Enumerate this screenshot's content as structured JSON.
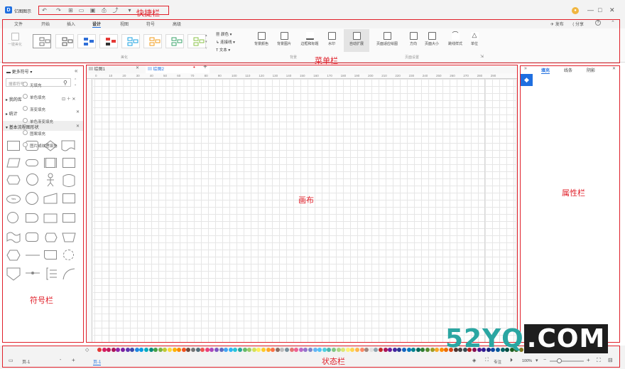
{
  "app": {
    "name": "亿图图示"
  },
  "titlebar": {
    "quick_label": "快捷栏",
    "window_controls": [
      "—",
      "□",
      "✕"
    ]
  },
  "tabs": [
    {
      "label": "文件"
    },
    {
      "label": "开始"
    },
    {
      "label": "插入"
    },
    {
      "label": "设计"
    },
    {
      "label": "视图"
    },
    {
      "label": "符号"
    },
    {
      "label": "高级"
    }
  ],
  "tabs_right": {
    "publish": "发布",
    "share": "分享",
    "help": "?"
  },
  "ribbon": {
    "menu_label": "菜单栏",
    "one_click": "一键美化",
    "color_label": "颜色",
    "connector_label": "连接线",
    "text_label": "文本",
    "beautify_group": "美化",
    "bg_group": "背景",
    "layout_group": "页面设置",
    "buttons": {
      "bg_color": "背景颜色",
      "bg_image": "背景图片",
      "border_title": "边框和标题",
      "watermark": "水印",
      "auto_expand": "自动扩展",
      "fit_page": "页面适应绘图",
      "orientation": "方向",
      "page_size": "页面大小",
      "jump_style": "跳线样式",
      "unit": "单位"
    }
  },
  "leftpanel": {
    "title": "更多符号",
    "search_placeholder": "搜索符号",
    "my_library": "我的库",
    "stats": "统计",
    "basic_shapes": "基本流程图形状",
    "label": "符号栏"
  },
  "doctabs": [
    {
      "label": "绘图1"
    },
    {
      "label": "绘图2"
    }
  ],
  "canvas": {
    "label": "画布"
  },
  "ruler_ticks": [
    "0",
    "10",
    "20",
    "30",
    "40",
    "50",
    "60",
    "70",
    "80",
    "90",
    "100",
    "110",
    "120",
    "130",
    "140",
    "150",
    "160",
    "170",
    "180",
    "190",
    "200",
    "210",
    "220",
    "230",
    "240",
    "250",
    "260",
    "270",
    "280",
    "290"
  ],
  "rightpanel": {
    "tabs": [
      "填充",
      "线条",
      "阴影"
    ],
    "options": [
      "无填充",
      "单色填充",
      "渐变填充",
      "单色渐变填充",
      "图案填充",
      "图片或纹理填充"
    ],
    "label": "属性栏"
  },
  "statusbar": {
    "page_name": "页-1",
    "page_tab": "页-1",
    "focus": "专注",
    "zoom": "100%",
    "label": "状态栏"
  },
  "palette": [
    "#e53935",
    "#d81b60",
    "#c2185b",
    "#ad1457",
    "#8e24aa",
    "#7b1fa2",
    "#5e35b1",
    "#3949ab",
    "#1e88e5",
    "#039be5",
    "#00acc1",
    "#00897b",
    "#43a047",
    "#7cb342",
    "#c0ca33",
    "#fdd835",
    "#ffb300",
    "#fb8c00",
    "#f4511e",
    "#6d4c41",
    "#757575",
    "#546e7a",
    "#ef5350",
    "#ec407a",
    "#ab47bc",
    "#7e57c2",
    "#5c6bc0",
    "#42a5f5",
    "#29b6f6",
    "#26c6da",
    "#26a69a",
    "#66bb6a",
    "#9ccc65",
    "#d4e157",
    "#ffee58",
    "#ffca28",
    "#ffa726",
    "#ff7043",
    "#8d6e63",
    "#bdbdbd",
    "#78909c",
    "#e57373",
    "#f06292",
    "#ba68c8",
    "#9575cd",
    "#7986cb",
    "#64b5f6",
    "#4fc3f7",
    "#4dd0e1",
    "#4db6ac",
    "#81c784",
    "#aed581",
    "#dce775",
    "#fff176",
    "#ffd54f",
    "#ffb74d",
    "#ff8a65",
    "#a1887f",
    "#e0e0e0",
    "#90a4ae",
    "#c62828",
    "#ad1457",
    "#6a1b9a",
    "#4527a0",
    "#283593",
    "#1565c0",
    "#0277bd",
    "#00838f",
    "#00695c",
    "#2e7d32",
    "#558b2f",
    "#9e9d24",
    "#f9a825",
    "#ff8f00",
    "#ef6c00",
    "#d84315",
    "#4e342e",
    "#424242",
    "#37474f",
    "#b71c1c",
    "#880e4f",
    "#4a148c",
    "#311b92",
    "#1a237e",
    "#0d47a1",
    "#01579b",
    "#006064",
    "#004d40",
    "#1b5e20",
    "#33691e",
    "#827717",
    "#f57f17"
  ],
  "watermark": {
    "left": "52YQ",
    "right": ".COM"
  }
}
